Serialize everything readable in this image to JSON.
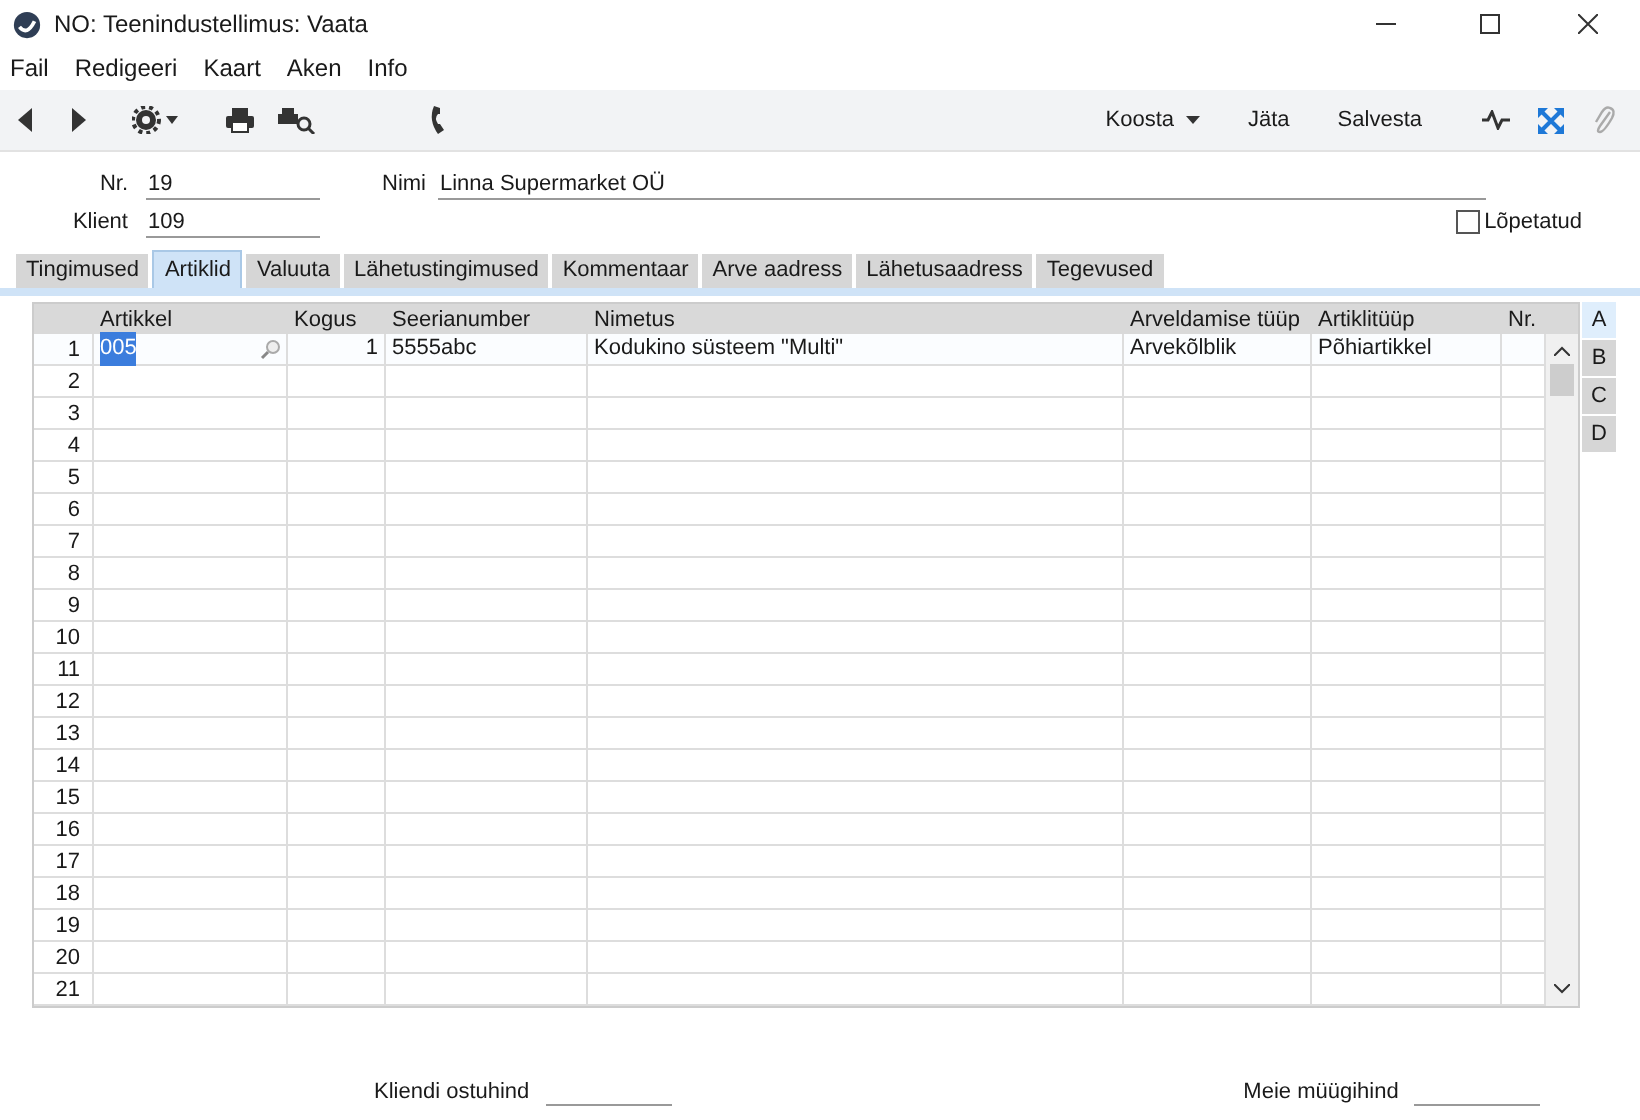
{
  "window": {
    "title": "NO: Teenindustellimus: Vaata"
  },
  "menu": [
    "Fail",
    "Redigeeri",
    "Kaart",
    "Aken",
    "Info"
  ],
  "toolbar": {
    "buttons": [
      {
        "label": "Koosta",
        "kind": "dropdown"
      },
      {
        "label": "Jäta",
        "kind": "plain"
      },
      {
        "label": "Salvesta",
        "kind": "plain"
      }
    ]
  },
  "header": {
    "nr": {
      "label": "Nr.",
      "value": "19"
    },
    "klient": {
      "label": "Klient",
      "value": "109"
    },
    "nimi": {
      "label": "Nimi",
      "value": "Linna Supermarket OÜ"
    },
    "lopetatud": {
      "label": "Lõpetatud",
      "checked": false
    }
  },
  "tabs": [
    {
      "label": "Tingimused",
      "selected": false
    },
    {
      "label": "Artiklid",
      "selected": true
    },
    {
      "label": "Valuuta",
      "selected": false
    },
    {
      "label": "Lähetustingimused",
      "selected": false
    },
    {
      "label": "Kommentaar",
      "selected": false
    },
    {
      "label": "Arve aadress",
      "selected": false
    },
    {
      "label": "Lähetusaadress",
      "selected": false
    },
    {
      "label": "Tegevused",
      "selected": false
    }
  ],
  "table": {
    "columns": [
      "Artikkel",
      "Kogus",
      "Seerianumber",
      "Nimetus",
      "Arveldamise tüüp",
      "Artiklitüüp",
      "Nr."
    ],
    "rows": [
      {
        "number": "1",
        "selected": true,
        "cells": [
          "005",
          "1",
          "5555abc",
          "Kodukino süsteem \"Multi\"",
          "Arvekõlblik",
          "Põhiartikkel"
        ]
      },
      {
        "number": "2",
        "selected": false
      },
      {
        "number": "3",
        "selected": false
      },
      {
        "number": "4",
        "selected": false
      },
      {
        "number": "5",
        "selected": false
      },
      {
        "number": "6",
        "selected": false
      },
      {
        "number": "7",
        "selected": false
      },
      {
        "number": "8",
        "selected": false
      },
      {
        "number": "9",
        "selected": false
      },
      {
        "number": "10",
        "selected": false
      },
      {
        "number": "11",
        "selected": false
      },
      {
        "number": "12",
        "selected": false
      },
      {
        "number": "13",
        "selected": false
      },
      {
        "number": "14",
        "selected": false
      },
      {
        "number": "15",
        "selected": false
      },
      {
        "number": "16",
        "selected": false
      },
      {
        "number": "17",
        "selected": false
      },
      {
        "number": "18",
        "selected": false
      },
      {
        "number": "19",
        "selected": false
      },
      {
        "number": "20",
        "selected": false
      },
      {
        "number": "21",
        "selected": false
      }
    ]
  },
  "side_tabs": [
    {
      "label": "A",
      "selected": true
    },
    {
      "label": "B",
      "selected": false
    },
    {
      "label": "C",
      "selected": false
    },
    {
      "label": "D",
      "selected": false
    }
  ],
  "footer": [
    {
      "label": "Kliendi ostuhind"
    },
    {
      "label": "Meie müügihind"
    }
  ]
}
